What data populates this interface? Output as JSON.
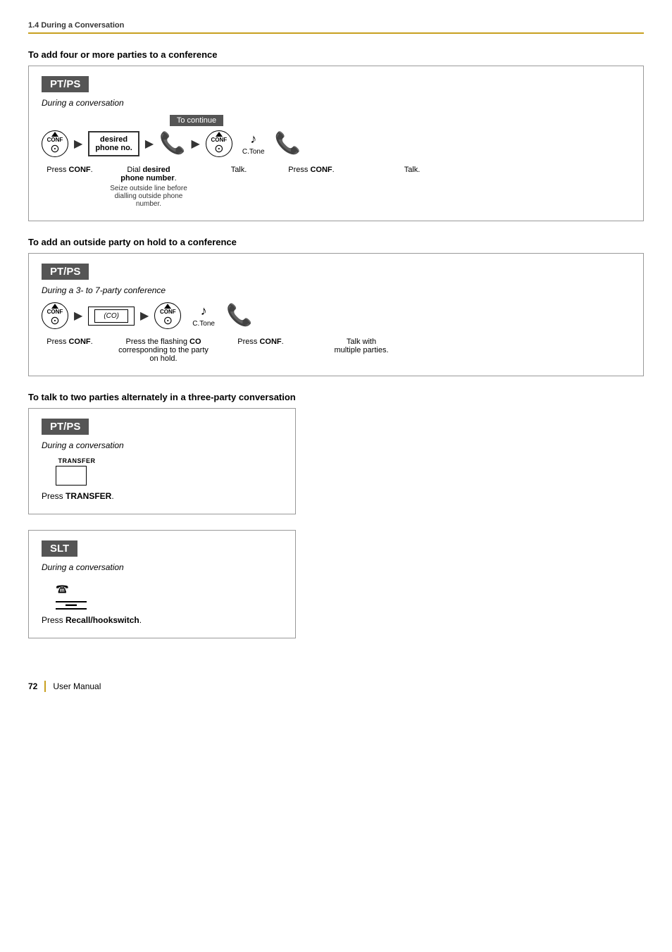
{
  "page": {
    "section": "1.4 During a Conversation",
    "footer": {
      "page_number": "72",
      "label": "User Manual"
    }
  },
  "section1": {
    "title": "To add four or more parties to a conference",
    "box": {
      "device": "PT/PS",
      "context": "During a conversation",
      "to_continue": "To continue",
      "steps": [
        {
          "label": "Press CONF.",
          "icon": "conf"
        },
        {
          "label": "Dial desired\nphone number.",
          "icon": "desired-box",
          "note": "Seize outside line before\ndialling outside phone number."
        },
        {
          "label": "Talk.",
          "icon": "phone"
        },
        {
          "label": "Press CONF.",
          "icon": "conf"
        },
        {
          "label": "",
          "icon": "ctone",
          "sublabel": "C.Tone"
        },
        {
          "label": "Talk.",
          "icon": "phone"
        }
      ]
    }
  },
  "section2": {
    "title": "To add an outside party on hold to a conference",
    "box": {
      "device": "PT/PS",
      "context": "During a 3- to 7-party conference",
      "steps": [
        {
          "label": "Press CONF.",
          "icon": "conf"
        },
        {
          "label": "Press the flashing CO\ncorresponding to the party\non hold.",
          "icon": "co-box"
        },
        {
          "label": "Press CONF.",
          "icon": "conf"
        },
        {
          "label": "",
          "icon": "ctone",
          "sublabel": "C.Tone"
        },
        {
          "label": "Talk with\nmultiple parties.",
          "icon": "phone"
        }
      ]
    }
  },
  "section3": {
    "title": "To talk to two parties alternately in a three-party conversation",
    "box_pt": {
      "device": "PT/PS",
      "context": "During a conversation",
      "step_label": "Press TRANSFER."
    },
    "box_slt": {
      "device": "SLT",
      "context": "During a conversation",
      "step_label": "Press Recall/hookswitch."
    }
  },
  "icons": {
    "arrow_right": "▶",
    "phone_with_waves": "📞",
    "conf_label": "CONF",
    "transfer_label": "TRANSFER"
  }
}
